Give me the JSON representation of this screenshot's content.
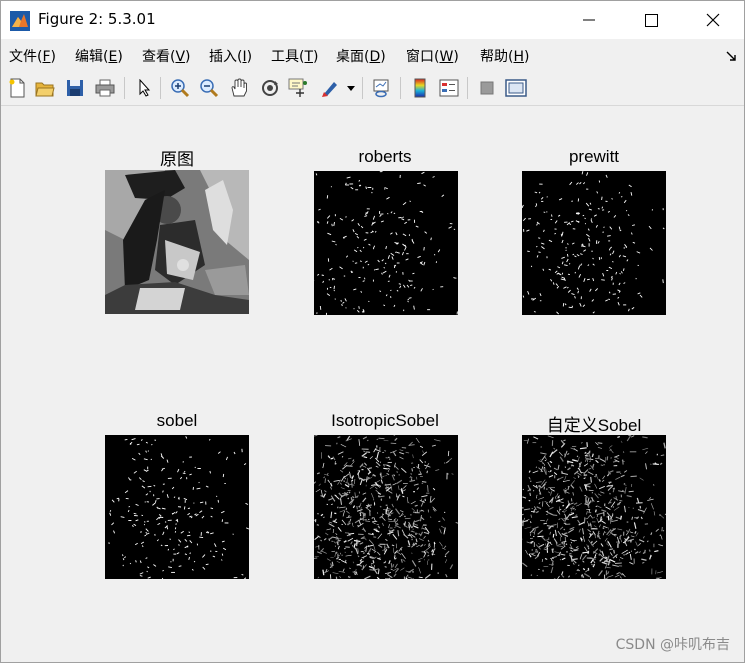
{
  "window": {
    "title": "Figure 2: 5.3.01"
  },
  "menubar": {
    "items": [
      {
        "label": "文件(",
        "key": "F",
        "end": ")"
      },
      {
        "label": "编辑(",
        "key": "E",
        "end": ")"
      },
      {
        "label": "查看(",
        "key": "V",
        "end": ")"
      },
      {
        "label": "插入(",
        "key": "I",
        "end": ")"
      },
      {
        "label": "工具(",
        "key": "T",
        "end": ")"
      },
      {
        "label": "桌面(",
        "key": "D",
        "end": ")"
      },
      {
        "label": "窗口(",
        "key": "W",
        "end": ")"
      },
      {
        "label": "帮助(",
        "key": "H",
        "end": ")"
      }
    ]
  },
  "toolbar": {
    "icons": [
      "new-figure-icon",
      "open-file-icon",
      "save-icon",
      "print-icon",
      "pointer-icon",
      "zoom-in-icon",
      "zoom-out-icon",
      "pan-hand-icon",
      "rotate-3d-icon",
      "data-cursor-icon",
      "brush-icon",
      "link-plot-icon",
      "colorbar-icon",
      "legend-icon",
      "hide-plot-tools-icon",
      "show-plot-tools-icon"
    ]
  },
  "subplots": [
    {
      "title": "原图",
      "kind": "gray"
    },
    {
      "title": "roberts",
      "kind": "sparse"
    },
    {
      "title": "prewitt",
      "kind": "sparse"
    },
    {
      "title": "sobel",
      "kind": "sparse"
    },
    {
      "title": "IsotropicSobel",
      "kind": "dense"
    },
    {
      "title": "自定义Sobel",
      "kind": "dense"
    }
  ],
  "watermark": "CSDN @咔叽布吉"
}
